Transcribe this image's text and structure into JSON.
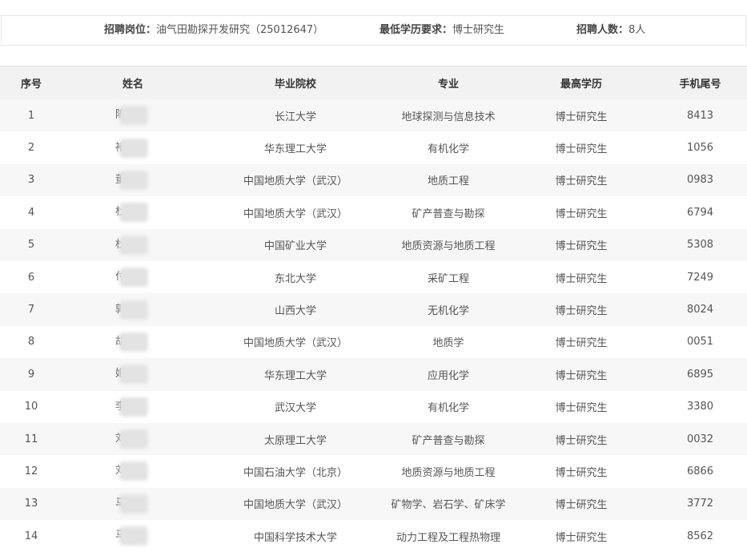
{
  "header": {
    "position_label": "招聘岗位：",
    "position_value": "油气田勘探开发研究（25012647）",
    "education_label": "最低学历要求：",
    "education_value": "博士研究生",
    "count_label": "招聘人数：",
    "count_value": "8人"
  },
  "table": {
    "columns": [
      "序号",
      "姓名",
      "毕业院校",
      "专业",
      "最高学历",
      "手机尾号"
    ],
    "rows": [
      {
        "index": "1",
        "name": "陈",
        "school": "长江大学",
        "major": "地球探测与信息技术",
        "degree": "博士研究生",
        "phone": "8413"
      },
      {
        "index": "2",
        "name": "褚",
        "school": "华东理工大学",
        "major": "有机化学",
        "degree": "博士研究生",
        "phone": "1056"
      },
      {
        "index": "3",
        "name": "董",
        "school": "中国地质大学（武汉）",
        "major": "地质工程",
        "degree": "博士研究生",
        "phone": "0983"
      },
      {
        "index": "4",
        "name": "杜",
        "school": "中国地质大学（武汉）",
        "major": "矿产普查与勘探",
        "degree": "博士研究生",
        "phone": "6794"
      },
      {
        "index": "5",
        "name": "杜",
        "school": "中国矿业大学",
        "major": "地质资源与地质工程",
        "degree": "博士研究生",
        "phone": "5308"
      },
      {
        "index": "6",
        "name": "付",
        "school": "东北大学",
        "major": "采矿工程",
        "degree": "博士研究生",
        "phone": "7249"
      },
      {
        "index": "7",
        "name": "郭",
        "school": "山西大学",
        "major": "无机化学",
        "degree": "博士研究生",
        "phone": "8024"
      },
      {
        "index": "8",
        "name": "胡",
        "school": "中国地质大学（武汉）",
        "major": "地质学",
        "degree": "博士研究生",
        "phone": "0051"
      },
      {
        "index": "9",
        "name": "姬",
        "school": "华东理工大学",
        "major": "应用化学",
        "degree": "博士研究生",
        "phone": "6895"
      },
      {
        "index": "10",
        "name": "李",
        "school": "武汉大学",
        "major": "有机化学",
        "degree": "博士研究生",
        "phone": "3380"
      },
      {
        "index": "11",
        "name": "刘",
        "school": "太原理工大学",
        "major": "矿产普查与勘探",
        "degree": "博士研究生",
        "phone": "0032"
      },
      {
        "index": "12",
        "name": "刘",
        "school": "中国石油大学（北京）",
        "major": "地质资源与地质工程",
        "degree": "博士研究生",
        "phone": "6866"
      },
      {
        "index": "13",
        "name": "马",
        "school": "中国地质大学（武汉）",
        "major": "矿物学、岩石学、矿床学",
        "degree": "博士研究生",
        "phone": "3772"
      },
      {
        "index": "14",
        "name": "马",
        "school": "中国科学技术大学",
        "major": "动力工程及工程热物理",
        "degree": "博士研究生",
        "phone": "8562"
      }
    ]
  }
}
